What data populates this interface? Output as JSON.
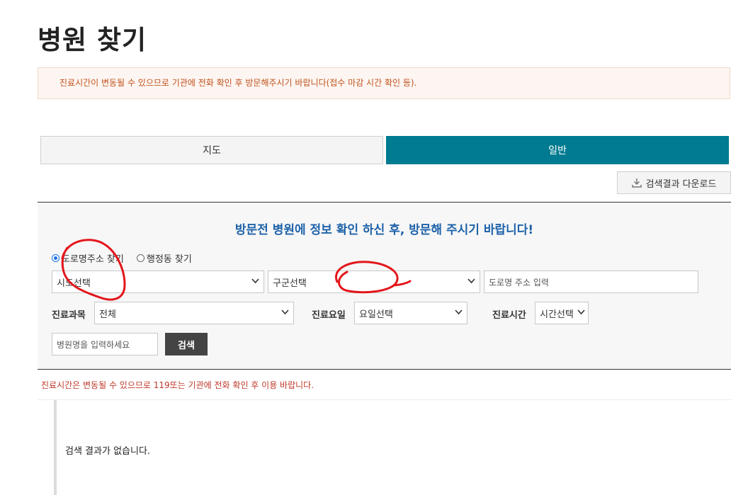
{
  "page": {
    "title": "병원 찾기",
    "notice": "진료시간이 변동될 수 있으므로 기관에 전화 확인 후 방문해주시기 바랍니다(접수 마감 시간 확인 등)."
  },
  "tabs": [
    {
      "label": "지도",
      "active": false
    },
    {
      "label": "일반",
      "active": true
    }
  ],
  "toolbar": {
    "download_label": "검색결과 다운로드",
    "download_icon": "download-icon"
  },
  "search": {
    "heading": "방문전 병원에 정보 확인 하신 후, 방문해 주시기 바랍니다!",
    "address_modes": [
      {
        "label": "도로명주소 찾기",
        "checked": true
      },
      {
        "label": "행정동 찾기",
        "checked": false
      }
    ],
    "sido_select": "시도선택",
    "gugun_select": "구군선택",
    "road_address_placeholder": "도로명 주소 입력",
    "department_label": "진료과목",
    "department_value": "전체",
    "day_label": "진료요일",
    "day_value": "요일선택",
    "time_label": "진료시간",
    "time_value": "시간선택",
    "hospital_name_placeholder": "병원명을 입력하세요",
    "search_button": "검색"
  },
  "warning": "진료시간은 변동될 수 있으므로 119또는 기관에 전화 확인 후 이용 바랍니다.",
  "results": {
    "empty_message": "검색 결과가 없습니다."
  },
  "colors": {
    "accent": "#007b91",
    "heading_blue": "#1e62a9",
    "warning_red": "#c0392b",
    "annotation_red": "#e3161b"
  }
}
